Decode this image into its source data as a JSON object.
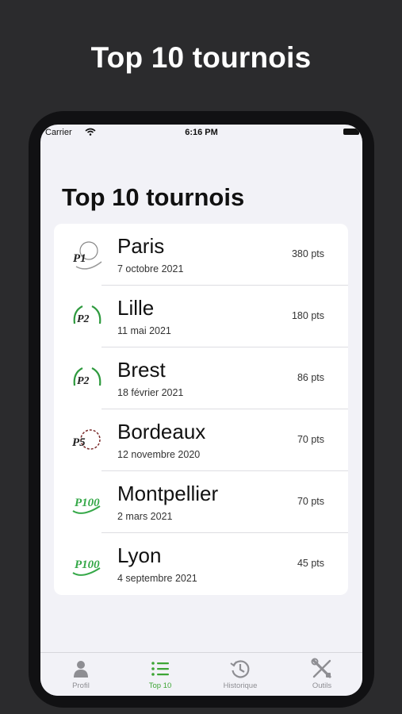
{
  "headline": "Top 10 tournois",
  "status_bar": {
    "carrier": "Carrier",
    "time": "6:16 PM"
  },
  "screen_title": "Top 10 tournois",
  "tournaments": [
    {
      "name": "Paris",
      "date": "7 octobre 2021",
      "points": "380 pts",
      "logo_color": "#222222"
    },
    {
      "name": "Lille",
      "date": "11 mai 2021",
      "points": "180 pts",
      "logo_color": "#2e9a3e"
    },
    {
      "name": "Brest",
      "date": "18 février 2021",
      "points": "86 pts",
      "logo_color": "#2e9a3e"
    },
    {
      "name": "Bordeaux",
      "date": "12 novembre 2020",
      "points": "70 pts",
      "logo_color": "#7a2a2a"
    },
    {
      "name": "Montpellier",
      "date": "2 mars 2021",
      "points": "70 pts",
      "logo_color": "#35a848"
    },
    {
      "name": "Lyon",
      "date": "4 septembre 2021",
      "points": "45 pts",
      "logo_color": "#35a848"
    }
  ],
  "tabs": [
    {
      "label": "Profil",
      "icon": "person-icon"
    },
    {
      "label": "Top 10",
      "icon": "list-icon"
    },
    {
      "label": "Historique",
      "icon": "history-icon"
    },
    {
      "label": "Outils",
      "icon": "tools-icon"
    }
  ],
  "colors": {
    "accent": "#3da535",
    "inactive": "#8e8e93"
  }
}
